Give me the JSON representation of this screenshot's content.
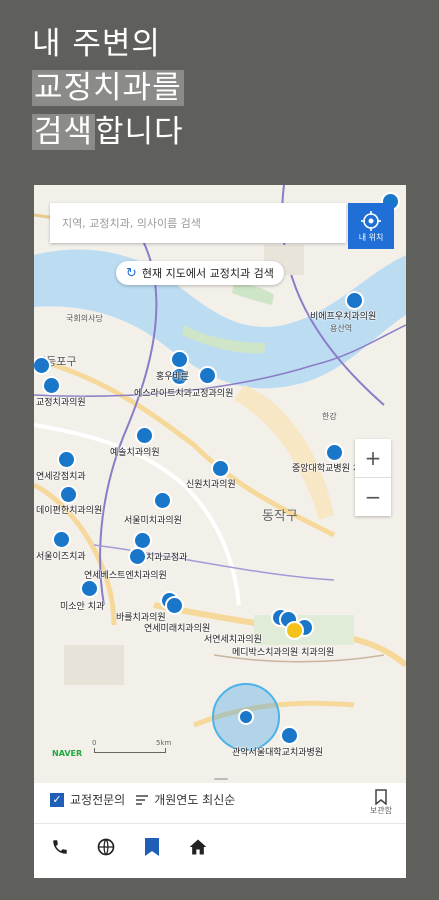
{
  "headline": {
    "line1": "내 주변의",
    "line2": "교정치과를",
    "line3_hl": "검색",
    "line3_rest": "합니다"
  },
  "search": {
    "placeholder": "지역, 교정치과, 의사이름 검색"
  },
  "my_location_label": "내 위치",
  "research_label": "현재 지도에서 교정치과 검색",
  "zoom": {
    "in": "+",
    "out": "−"
  },
  "map": {
    "places": [
      "국회의사당",
      "영등포구",
      "한강",
      "용산역",
      "동작구"
    ],
    "clinics": [
      "비에프우치과의원",
      "홍우바른",
      "에스라이트치과교정과의원",
      "교정치과의원",
      "예솔치과의원",
      "중앙대학교병원 치과",
      "신원치과의원",
      "연세강점치과",
      "데이편한치과의원",
      "서울미치과의원",
      "서울이즈치과",
      "치과교정과",
      "연세베스트엔치과의원",
      "미소안 치과",
      "바를치과의원",
      "연세미래치과의원",
      "서연세치과의원",
      "메디박스치과의원 치과의원",
      "관악서울대학교치과병원"
    ],
    "naver": "NAVER",
    "scale_zero": "0",
    "scale_label": "5km"
  },
  "filters": {
    "orthodontist_label": "교정전문의",
    "sort_label": "개원연도 최신순",
    "bookmark_label": "보관함"
  },
  "colors": {
    "accent": "#1f6fd6",
    "pin": "#1a76c8",
    "pin_highlight": "#f4c21b",
    "background": "#5f605c"
  },
  "tabs": [
    "phone-icon",
    "globe-icon",
    "bookmark-icon",
    "home-icon"
  ]
}
